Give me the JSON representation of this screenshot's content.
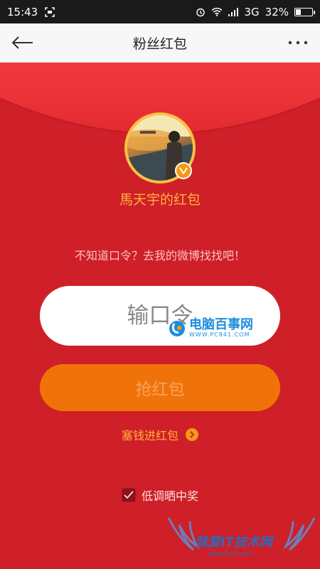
{
  "status_bar": {
    "time": "15:43",
    "network": "3G",
    "battery": "32%",
    "battery_level": 0.32
  },
  "header": {
    "title": "粉丝红包"
  },
  "icons": {
    "back": "arrow-left-icon",
    "more": "more-dots-icon",
    "verify": "verified-v-icon",
    "chevron": "chevron-right-icon",
    "check": "check-icon"
  },
  "envelope": {
    "owner": "馬天宇的红包",
    "hint": "不知道口令？去我的微博找找吧！",
    "input_placeholder": "输口令",
    "grab_button": "抢红包",
    "deposit_link": "塞钱进红包",
    "lottery_option": "低调晒中奖",
    "lottery_checked": true
  },
  "watermarks": {
    "site1_title": "电脑百事网",
    "site1_url": "WWW.PC841.COM",
    "site2_title": "我爱IT技术网",
    "site2_url": "www.5ait.com"
  },
  "colors": {
    "envelope_red": "#cf1f28",
    "button_orange": "#f0730a",
    "accent_gold": "#ffb23c"
  }
}
